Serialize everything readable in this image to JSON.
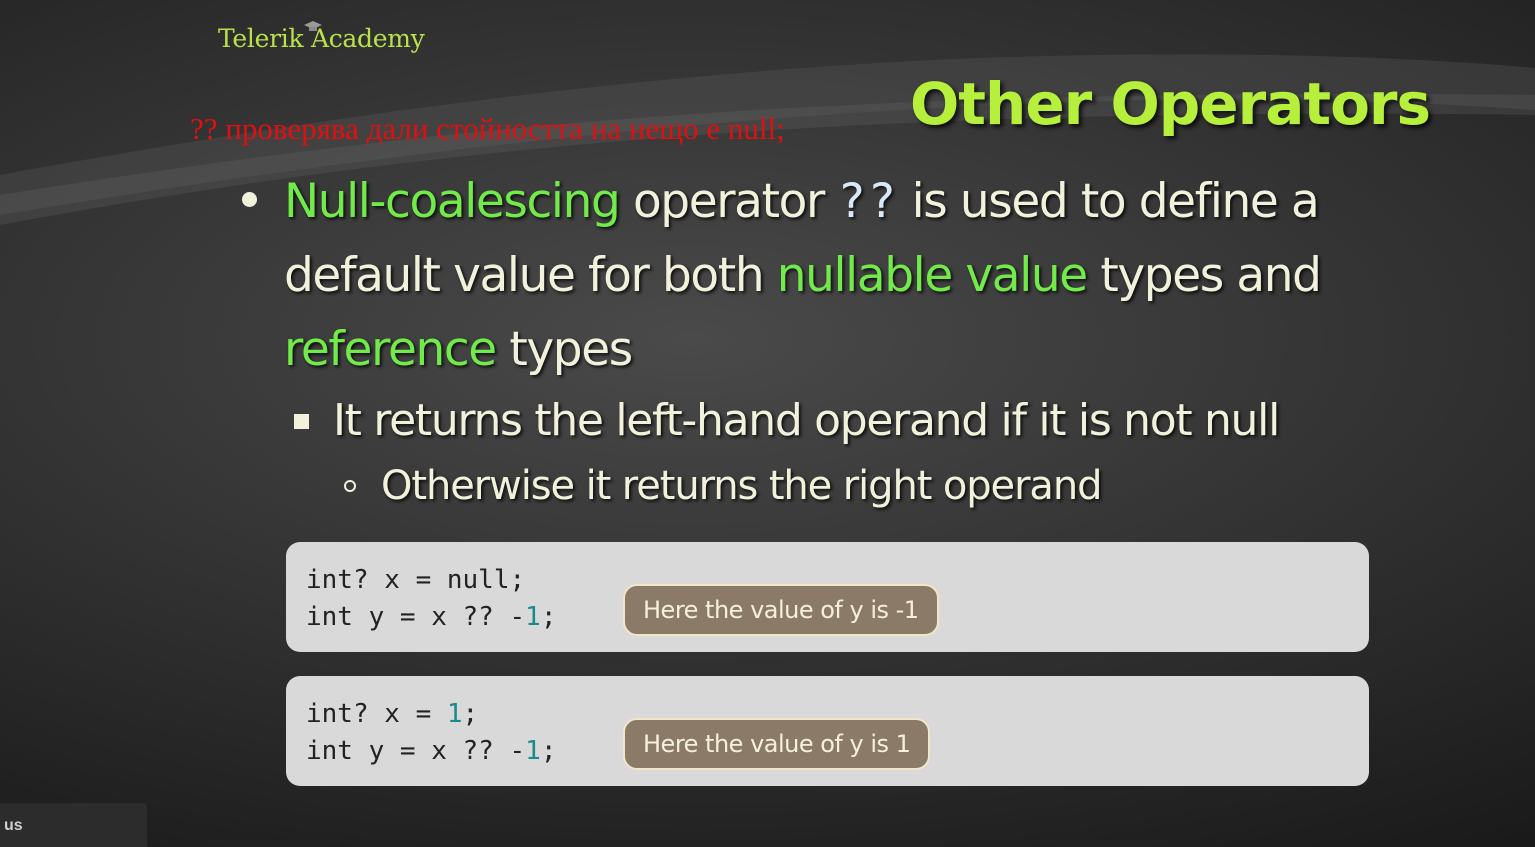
{
  "logo": {
    "text": "Telerik Academy"
  },
  "note": {
    "text": "?? проверява дали стойността на нещо е null;"
  },
  "title": {
    "text": "Other Operators"
  },
  "bullet1": {
    "part1": "Null-coalescing",
    "part2": " operator ",
    "operator": "??",
    "part3": " is used to define a default value for both ",
    "part4": "nullable value",
    "part5": " types and ",
    "part6": "reference",
    "part7": " types"
  },
  "bullet2": {
    "text": "It returns the left-hand operand if it is not null"
  },
  "bullet3": {
    "text": "Otherwise it returns the right operand"
  },
  "example1": {
    "line1_text": "int? x = null;",
    "line2_prefix": "int y = x ?? -",
    "line2_num": "1",
    "line2_suffix": ";",
    "callout": "Here the value of y is -1"
  },
  "example2": {
    "line1_prefix": "int? x = ",
    "line1_num": "1",
    "line1_suffix": ";",
    "line2_prefix": "int y = x ?? -",
    "line2_num": "1",
    "line2_suffix": ";",
    "callout": "Here the value of y is 1"
  },
  "corner_tab": {
    "text": "us"
  },
  "colors": {
    "accent_green": "#b6ef3c",
    "highlight_green": "#72ea4a",
    "note_red": "#e01010",
    "callout_bg": "#8c7a68",
    "code_bg": "#d9d9d9"
  }
}
